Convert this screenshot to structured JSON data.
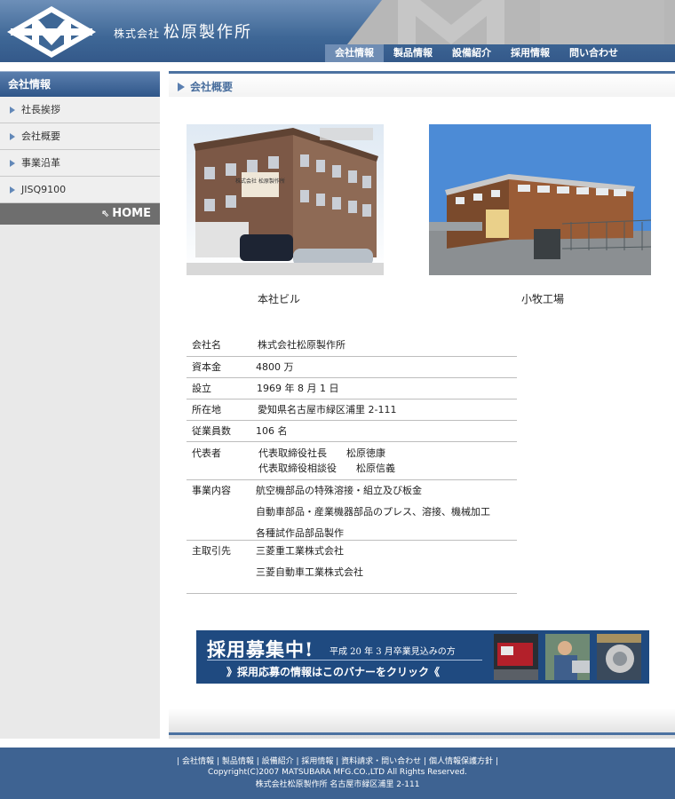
{
  "header": {
    "company_prefix": "株式会社",
    "company_name": "松原製作所",
    "nav": [
      {
        "label": "会社情報",
        "active": true
      },
      {
        "label": "製品情報"
      },
      {
        "label": "設備紹介"
      },
      {
        "label": "採用情報"
      },
      {
        "label": "問い合わせ"
      }
    ]
  },
  "sidebar": {
    "title": "会社情報",
    "items": [
      {
        "label": "社長挨拶"
      },
      {
        "label": "会社概要"
      },
      {
        "label": "事業沿革"
      },
      {
        "label": "JISQ9100"
      }
    ],
    "home": "HOME"
  },
  "main": {
    "title": "会社概要",
    "photos": [
      {
        "caption": "本社ビル",
        "sign": "株式会社 松原製作所"
      },
      {
        "caption": "小牧工場"
      }
    ],
    "profile": [
      {
        "key": "会社名",
        "values": [
          "株式会社松原製作所"
        ]
      },
      {
        "key": "資本金",
        "values": [
          "4800 万"
        ]
      },
      {
        "key": "設立",
        "values": [
          "1969 年 8 月 1 日"
        ]
      },
      {
        "key": "所在地",
        "values": [
          "愛知県名古屋市緑区浦里 2-111"
        ]
      },
      {
        "key": "従業員数",
        "values": [
          "106 名"
        ]
      },
      {
        "key": "代表者",
        "values": [
          "代表取締役社長　　松原徳康",
          "代表取締役相談役　　松原信義"
        ]
      },
      {
        "key": "事業内容",
        "values": [
          "航空機部品の特殊溶接・組立及び板金",
          "自動車部品・産業機器部品のプレス、溶接、機械加工",
          "各種試作品部品製作"
        ]
      },
      {
        "key": "主取引先",
        "values": [
          "三菱重工業株式会社",
          "三菱自動車工業株式会社"
        ]
      }
    ],
    "banner": {
      "title": "採用募集中!",
      "subtitle": "平成 20 年 3 月卒業見込みの方",
      "cta": "》採用応募の情報はこのバナーをクリック《"
    }
  },
  "footer": {
    "links": [
      "会社情報",
      "製品情報",
      "設備紹介",
      "採用情報",
      "資料請求・問い合わせ",
      "個人情報保護方針"
    ],
    "copyright": "Copyright(C)2007 MATSUBARA MFG.CO.,LTD All Rights Reserved.",
    "address": "株式会社松原製作所 名古屋市緑区浦里 2-111"
  },
  "colors": {
    "header_blue": "#3e6796",
    "nav_active": "#6f8db4",
    "accent_blue": "#4c72a1",
    "sidebar_bg": "#e9e9e9",
    "footer_blue": "#3e6392"
  }
}
